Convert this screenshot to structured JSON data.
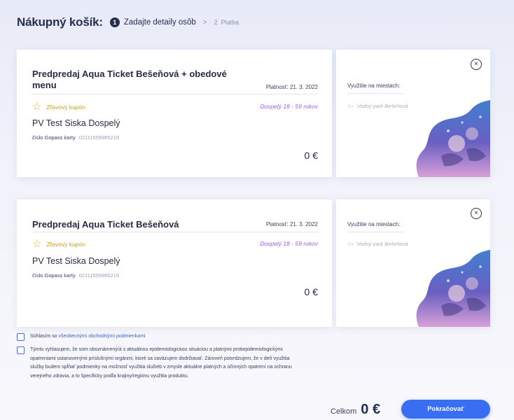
{
  "header": {
    "title": "Nákupný košík:",
    "step1_num": "1",
    "step1_label": "Zadajte detaily osôb",
    "separator": ">",
    "step2_num": "2",
    "step2_label": "Platba"
  },
  "tickets": [
    {
      "name": "Predpredaj Aqua Ticket Bešeňová + obedové menu",
      "validity": "Platnosť: 21. 3. 2022",
      "coupon": "Zľavový kupón",
      "age": "Dospelý 18 - 59 rokov",
      "person": "PV Test Siska Dospelý",
      "gopass_label": "číslo Gopass karty",
      "gopass_number": "02111559965219",
      "price": "0 €",
      "usage_label": "Využitie na miestach:",
      "place": "Vodný park Bešeňová",
      "close": "×"
    },
    {
      "name": "Predpredaj Aqua Ticket Bešeňová",
      "validity": "Platnosť: 21. 3. 2022",
      "coupon": "Zľavový kupón",
      "age": "Dospelý 18 - 59 rokov",
      "person": "PV Test Siska Dospelý",
      "gopass_label": "číslo Gopass karty",
      "gopass_number": "02111559965219",
      "price": "0 €",
      "usage_label": "Využitie na miestach:",
      "place": "Vodný park Bešeňová",
      "close": "×"
    }
  ],
  "consents": {
    "terms_prefix": "Súhlasím so ",
    "terms_link": "všeobecnými obchodnými podmienkami",
    "covid_text": "Týmto vyhlasujem, že som oboznámený/á s aktuálnou epidemiologickou situáciou a platnými protiepidemiologickými opatreniami ustanovenými príslušnými orgánmi, ktoré sa zaväzujem dodržiavať. Zároveň potvrdzujem, že v deň využitia služby budem spĺňať podmienky na možnosť využitia služieb v zmysle aktuálne platných a účinných opatrení na ochranu verejného zdravia, a to špecificky podľa krajiny/regiónu využitia produktu."
  },
  "footer": {
    "total_label": "Celkom",
    "total_value": "0 €",
    "continue_label": "Pokračovať"
  },
  "colors": {
    "accent": "#3a6ef2",
    "coupon": "#c7a01e",
    "age": "#a25fe0"
  }
}
